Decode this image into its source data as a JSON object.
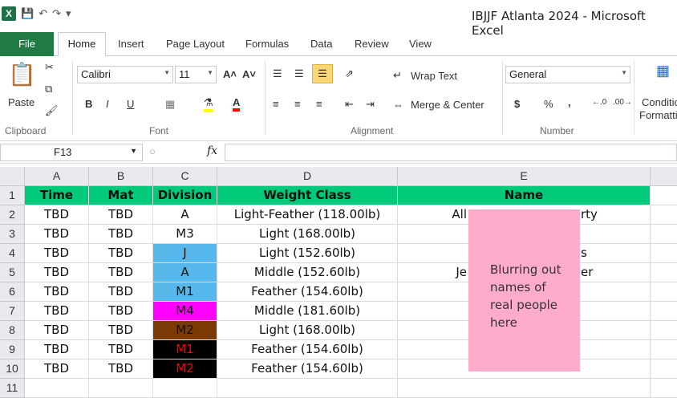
{
  "window": {
    "title": "IBJJF Atlanta 2024  -  Microsoft Excel"
  },
  "ribbon_tabs": [
    "File",
    "Home",
    "Insert",
    "Page Layout",
    "Formulas",
    "Data",
    "Review",
    "View"
  ],
  "clipboard": {
    "paste": "Paste",
    "group": "Clipboard"
  },
  "font": {
    "name": "Calibri",
    "size": "11",
    "group": "Font",
    "bold": "B",
    "italic": "I",
    "underline": "U"
  },
  "alignment": {
    "wrap": "Wrap Text",
    "merge": "Merge & Center",
    "group": "Alignment"
  },
  "number": {
    "format": "General",
    "currency": "$",
    "percent": "%",
    "comma": ",",
    "group": "Number"
  },
  "styles": {
    "conditional": "Conditio",
    "formatting": "Formatti"
  },
  "namebox": "F13",
  "columns": [
    "A",
    "B",
    "C",
    "D",
    "E"
  ],
  "rows": [
    "1",
    "2",
    "3",
    "4",
    "5",
    "6",
    "7",
    "8",
    "9",
    "10",
    "11"
  ],
  "headers": [
    "Time",
    "Mat",
    "Division",
    "Weight Class",
    "Name"
  ],
  "table": [
    {
      "time": "TBD",
      "mat": "TBD",
      "division": "A",
      "weight": "Light-Feather (118.00lb)",
      "name_left": "All",
      "name_right": "rty"
    },
    {
      "time": "TBD",
      "mat": "TBD",
      "division": "M3",
      "weight": "Light (168.00lb)",
      "name_left": "",
      "name_right": ""
    },
    {
      "time": "TBD",
      "mat": "TBD",
      "division": "J",
      "weight": "Light (152.60lb)",
      "name_left": "",
      "name_right": "s"
    },
    {
      "time": "TBD",
      "mat": "TBD",
      "division": "A",
      "weight": "Middle (152.60lb)",
      "name_left": "Je",
      "name_right": "er"
    },
    {
      "time": "TBD",
      "mat": "TBD",
      "division": "M1",
      "weight": "Feather (154.60lb)",
      "name_left": "",
      "name_right": ""
    },
    {
      "time": "TBD",
      "mat": "TBD",
      "division": "M4",
      "weight": "Middle (181.60lb)",
      "name_left": "",
      "name_right": ""
    },
    {
      "time": "TBD",
      "mat": "TBD",
      "division": "M2",
      "weight": "Light (168.00lb)",
      "name_left": "",
      "name_right": ""
    },
    {
      "time": "TBD",
      "mat": "TBD",
      "division": "M1",
      "weight": "Feather (154.60lb)",
      "name_left": "",
      "name_right": ""
    },
    {
      "time": "TBD",
      "mat": "TBD",
      "division": "M2",
      "weight": "Feather (154.60lb)",
      "name_left": "",
      "name_right": ""
    }
  ],
  "division_colors": [
    {
      "bg": "#ffffff",
      "fg": "#111111"
    },
    {
      "bg": "#ffffff",
      "fg": "#111111"
    },
    {
      "bg": "#56b8ea",
      "fg": "#111111"
    },
    {
      "bg": "#56b8ea",
      "fg": "#111111"
    },
    {
      "bg": "#56b8ea",
      "fg": "#111111"
    },
    {
      "bg": "#ff00ff",
      "fg": "#111111"
    },
    {
      "bg": "#7b3a05",
      "fg": "#111111"
    },
    {
      "bg": "#000000",
      "fg": "#ff0000"
    },
    {
      "bg": "#000000",
      "fg": "#ff0000"
    }
  ],
  "overlay_note": "Blurring out names of real people here"
}
